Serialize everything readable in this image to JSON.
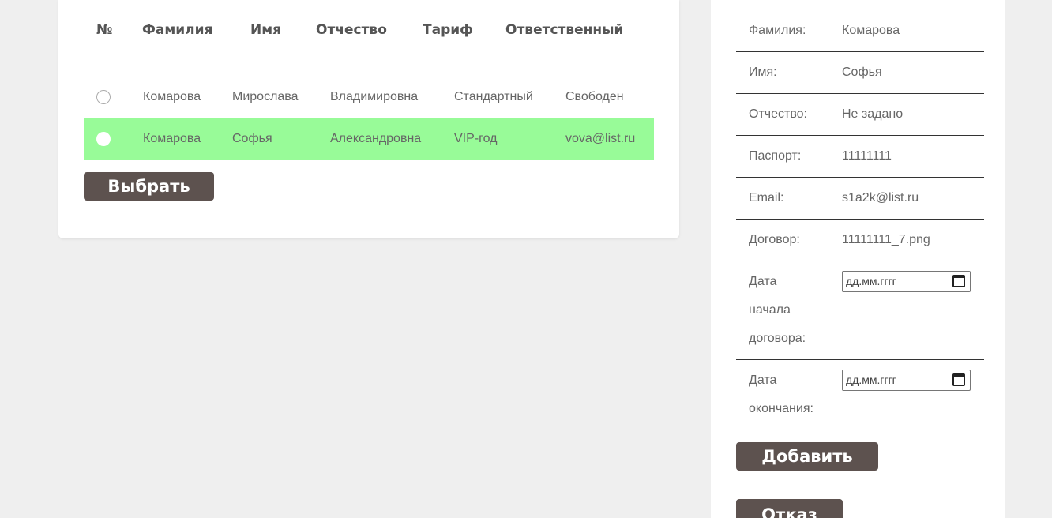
{
  "table": {
    "headers": {
      "num": "№",
      "surname": "Фамилия",
      "name": "Имя",
      "patronymic": "Отчество",
      "tariff": "Тариф",
      "responsible": "Ответственный"
    },
    "rows": [
      {
        "surname": "Комарова",
        "name": "Мирослава",
        "patronymic": "Владимировна",
        "tariff": "Стандартный",
        "responsible": "Свободен",
        "selected": false
      },
      {
        "surname": "Комарова",
        "name": "Софья",
        "patronymic": "Александровна",
        "tariff": "VIP-год",
        "responsible": "vova@list.ru",
        "selected": true
      }
    ],
    "select_button": "Выбрать",
    "highlight_color": "#98fb98"
  },
  "details": {
    "surname_label": "Фамилия:",
    "surname_value": "Комарова",
    "name_label": "Имя:",
    "name_value": "Софья",
    "patronymic_label": "Отчество:",
    "patronymic_value": "Не задано",
    "passport_label": "Паспорт:",
    "passport_value": "11111111",
    "email_label": "Email:",
    "email_value": "s1a2k@list.ru",
    "contract_label": "Договор:",
    "contract_value": "11111111_7.png",
    "start_date_label_1": "Дата",
    "start_date_label_2": "начала",
    "start_date_label_3": "договора:",
    "start_date_placeholder": "дд.мм.гггг",
    "end_date_label_1": "Дата",
    "end_date_label_2": "окончания:",
    "end_date_placeholder": "дд.мм.гггг",
    "add_button": "Добавить",
    "refuse_button": "Отказ"
  },
  "colors": {
    "button": "#5d524f",
    "page_bg": "#efefef"
  }
}
